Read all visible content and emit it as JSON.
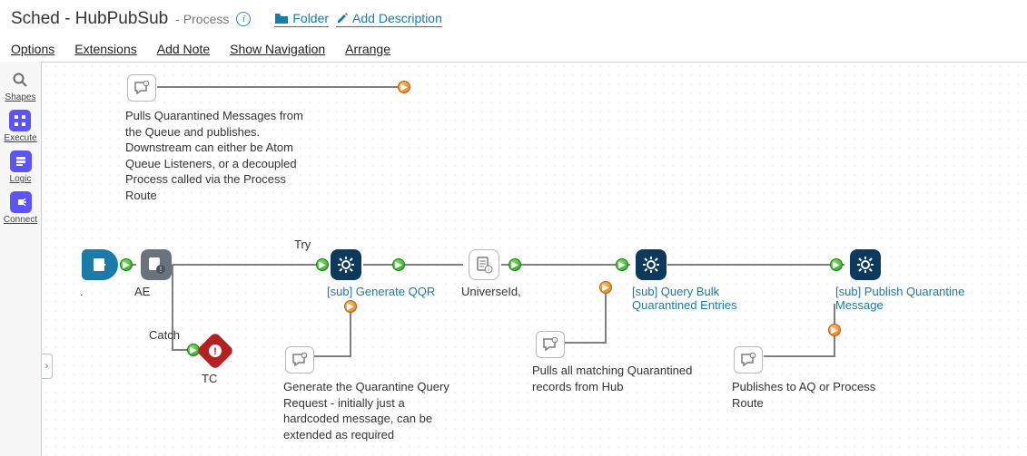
{
  "header": {
    "title": "Sched - HubPubSub",
    "subtitle": "- Process",
    "folder_label": "Folder",
    "add_desc_label": "Add Description"
  },
  "menu": {
    "options": "Options",
    "extensions": "Extensions",
    "add_note": "Add Note",
    "show_nav": "Show Navigation",
    "arrange": "Arrange"
  },
  "palette": {
    "shapes": "Shapes",
    "execute": "Execute",
    "logic": "Logic",
    "connect": "Connect"
  },
  "labels": {
    "start": ".",
    "ae": "AE",
    "try": "Try",
    "catch": "Catch",
    "tc": "TC",
    "qqr": "[sub] Generate QQR",
    "universe": "UniverseId,",
    "query": "[sub] Query Bulk Quarantined Entries",
    "publish": "[sub] Publish Quarantine Message"
  },
  "notes": {
    "top": "Pulls Quarantined Messages from the Queue and publishes. Downstream can either be Atom Queue Listeners, or a decoupled Process called via the Process Route",
    "qqr": "Generate the Quarantine Query Request - initially just a hardcoded message, can be extended as required",
    "query": "Pulls all matching Quarantined records from Hub",
    "publish": "Publishes to AQ or Process Route"
  },
  "icons": {
    "info": "i",
    "expand": "›"
  }
}
